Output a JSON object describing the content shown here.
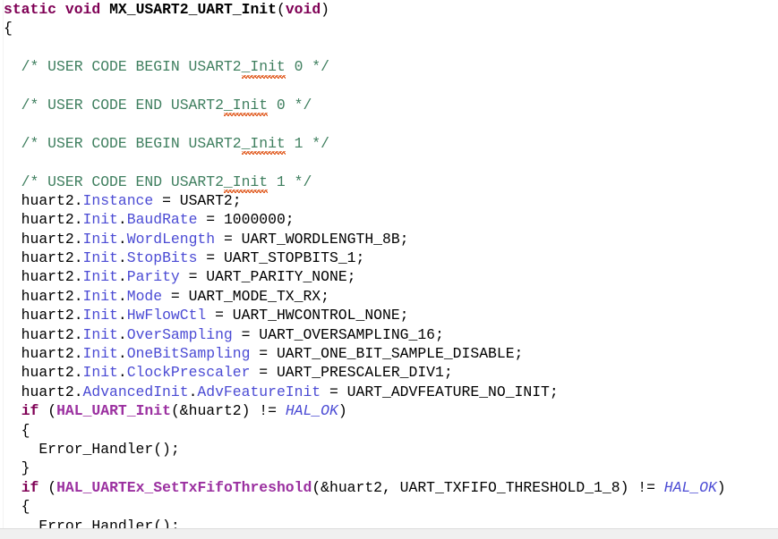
{
  "editor": {
    "app": "code-editor",
    "language": "c",
    "function_name": "MX_USART2_UART_Init",
    "background_color": "#ffffff",
    "colors": {
      "keyword": "#7f0055",
      "function": "#9b30a0",
      "field": "#4b4bd4",
      "macro": "#4b4bd4",
      "comment": "#3f7f5f",
      "plain": "#000000",
      "spellcheck_squiggle": "#e2622a",
      "scrollbar": "#f0f0f0"
    },
    "lines": [
      {
        "n": 1,
        "tokens": [
          {
            "t": "static",
            "c": "kw"
          },
          {
            "t": " ",
            "c": "plain"
          },
          {
            "t": "void",
            "c": "kw"
          },
          {
            "t": " ",
            "c": "plain"
          },
          {
            "t": "MX_USART2_UART_Init",
            "c": "fnblack"
          },
          {
            "t": "(",
            "c": "plain"
          },
          {
            "t": "void",
            "c": "kw"
          },
          {
            "t": ")",
            "c": "plain"
          }
        ]
      },
      {
        "n": 2,
        "tokens": [
          {
            "t": "{",
            "c": "plain"
          }
        ]
      },
      {
        "n": 3,
        "tokens": []
      },
      {
        "n": 4,
        "tokens": [
          {
            "t": "  /* USER CODE BEGIN USART2",
            "c": "cmt"
          },
          {
            "t": "_Init",
            "c": "cmt-squig"
          },
          {
            "t": " 0 */",
            "c": "cmt"
          }
        ]
      },
      {
        "n": 5,
        "tokens": []
      },
      {
        "n": 6,
        "tokens": [
          {
            "t": "  /* USER CODE END USART2",
            "c": "cmt"
          },
          {
            "t": "_Init",
            "c": "cmt-squig"
          },
          {
            "t": " 0 */",
            "c": "cmt"
          }
        ]
      },
      {
        "n": 7,
        "tokens": []
      },
      {
        "n": 8,
        "tokens": [
          {
            "t": "  /* USER CODE BEGIN USART2",
            "c": "cmt"
          },
          {
            "t": "_Init",
            "c": "cmt-squig"
          },
          {
            "t": " 1 */",
            "c": "cmt"
          }
        ]
      },
      {
        "n": 9,
        "tokens": []
      },
      {
        "n": 10,
        "tokens": [
          {
            "t": "  /* USER CODE END USART2",
            "c": "cmt"
          },
          {
            "t": "_Init",
            "c": "cmt-squig"
          },
          {
            "t": " 1 */",
            "c": "cmt"
          }
        ]
      },
      {
        "n": 11,
        "tokens": [
          {
            "t": "  huart2.",
            "c": "plain"
          },
          {
            "t": "Instance",
            "c": "field"
          },
          {
            "t": " = USART2;",
            "c": "plain"
          }
        ]
      },
      {
        "n": 12,
        "tokens": [
          {
            "t": "  huart2.",
            "c": "plain"
          },
          {
            "t": "Init",
            "c": "field"
          },
          {
            "t": ".",
            "c": "plain"
          },
          {
            "t": "BaudRate",
            "c": "field"
          },
          {
            "t": " = 1000000;",
            "c": "plain"
          }
        ]
      },
      {
        "n": 13,
        "tokens": [
          {
            "t": "  huart2.",
            "c": "plain"
          },
          {
            "t": "Init",
            "c": "field"
          },
          {
            "t": ".",
            "c": "plain"
          },
          {
            "t": "WordLength",
            "c": "field"
          },
          {
            "t": " = UART_WORDLENGTH_8B;",
            "c": "plain"
          }
        ]
      },
      {
        "n": 14,
        "tokens": [
          {
            "t": "  huart2.",
            "c": "plain"
          },
          {
            "t": "Init",
            "c": "field"
          },
          {
            "t": ".",
            "c": "plain"
          },
          {
            "t": "StopBits",
            "c": "field"
          },
          {
            "t": " = UART_STOPBITS_1;",
            "c": "plain"
          }
        ]
      },
      {
        "n": 15,
        "tokens": [
          {
            "t": "  huart2.",
            "c": "plain"
          },
          {
            "t": "Init",
            "c": "field"
          },
          {
            "t": ".",
            "c": "plain"
          },
          {
            "t": "Parity",
            "c": "field"
          },
          {
            "t": " = UART_PARITY_NONE;",
            "c": "plain"
          }
        ]
      },
      {
        "n": 16,
        "tokens": [
          {
            "t": "  huart2.",
            "c": "plain"
          },
          {
            "t": "Init",
            "c": "field"
          },
          {
            "t": ".",
            "c": "plain"
          },
          {
            "t": "Mode",
            "c": "field"
          },
          {
            "t": " = UART_MODE_TX_RX;",
            "c": "plain"
          }
        ]
      },
      {
        "n": 17,
        "tokens": [
          {
            "t": "  huart2.",
            "c": "plain"
          },
          {
            "t": "Init",
            "c": "field"
          },
          {
            "t": ".",
            "c": "plain"
          },
          {
            "t": "HwFlowCtl",
            "c": "field"
          },
          {
            "t": " = UART_HWCONTROL_NONE;",
            "c": "plain"
          }
        ]
      },
      {
        "n": 18,
        "tokens": [
          {
            "t": "  huart2.",
            "c": "plain"
          },
          {
            "t": "Init",
            "c": "field"
          },
          {
            "t": ".",
            "c": "plain"
          },
          {
            "t": "OverSampling",
            "c": "field"
          },
          {
            "t": " = UART_OVERSAMPLING_16;",
            "c": "plain"
          }
        ]
      },
      {
        "n": 19,
        "tokens": [
          {
            "t": "  huart2.",
            "c": "plain"
          },
          {
            "t": "Init",
            "c": "field"
          },
          {
            "t": ".",
            "c": "plain"
          },
          {
            "t": "OneBitSampling",
            "c": "field"
          },
          {
            "t": " = UART_ONE_BIT_SAMPLE_DISABLE;",
            "c": "plain"
          }
        ]
      },
      {
        "n": 20,
        "tokens": [
          {
            "t": "  huart2.",
            "c": "plain"
          },
          {
            "t": "Init",
            "c": "field"
          },
          {
            "t": ".",
            "c": "plain"
          },
          {
            "t": "ClockPrescaler",
            "c": "field"
          },
          {
            "t": " = UART_PRESCALER_DIV1;",
            "c": "plain"
          }
        ]
      },
      {
        "n": 21,
        "tokens": [
          {
            "t": "  huart2.",
            "c": "plain"
          },
          {
            "t": "AdvancedInit",
            "c": "field"
          },
          {
            "t": ".",
            "c": "plain"
          },
          {
            "t": "AdvFeatureInit",
            "c": "field"
          },
          {
            "t": " = UART_ADVFEATURE_NO_INIT;",
            "c": "plain"
          }
        ]
      },
      {
        "n": 22,
        "tokens": [
          {
            "t": "  ",
            "c": "plain"
          },
          {
            "t": "if",
            "c": "kw"
          },
          {
            "t": " (",
            "c": "plain"
          },
          {
            "t": "HAL_UART_Init",
            "c": "fn"
          },
          {
            "t": "(&huart2) != ",
            "c": "plain"
          },
          {
            "t": "HAL_OK",
            "c": "macro"
          },
          {
            "t": ")",
            "c": "plain"
          }
        ]
      },
      {
        "n": 23,
        "tokens": [
          {
            "t": "  {",
            "c": "plain"
          }
        ]
      },
      {
        "n": 24,
        "tokens": [
          {
            "t": "    Error_Handler();",
            "c": "plain"
          }
        ]
      },
      {
        "n": 25,
        "tokens": [
          {
            "t": "  }",
            "c": "plain"
          }
        ]
      },
      {
        "n": 26,
        "tokens": [
          {
            "t": "  ",
            "c": "plain"
          },
          {
            "t": "if",
            "c": "kw"
          },
          {
            "t": " (",
            "c": "plain"
          },
          {
            "t": "HAL_UARTEx_SetTxFifoThreshold",
            "c": "fn"
          },
          {
            "t": "(&huart2, UART_TXFIFO_THRESHOLD_1_8) != ",
            "c": "plain"
          },
          {
            "t": "HAL_OK",
            "c": "macro"
          },
          {
            "t": ")",
            "c": "plain"
          }
        ]
      },
      {
        "n": 27,
        "tokens": [
          {
            "t": "  {",
            "c": "plain"
          }
        ]
      },
      {
        "n": 28,
        "tokens": [
          {
            "t": "    Error_Handler();",
            "c": "plain"
          }
        ]
      }
    ]
  }
}
